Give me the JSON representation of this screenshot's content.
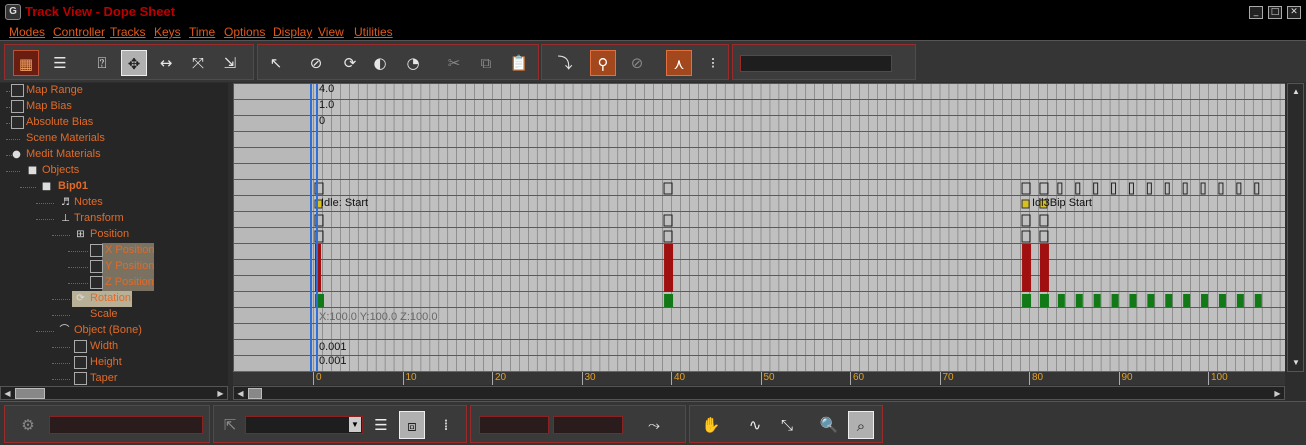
{
  "window": {
    "title": "Track View - Dope Sheet",
    "app_icon": "3ds-max-icon",
    "controls": [
      "minimize-icon",
      "maximize-icon",
      "close-icon"
    ]
  },
  "menu": [
    "Modes",
    "Controller",
    "Tracks",
    "Keys",
    "Time",
    "Options",
    "Display",
    "View",
    "Utilities"
  ],
  "toolbar": {
    "buttons": [
      "edit-keys-icon",
      "edit-ranges-icon",
      "filters-icon",
      "move-keys-icon",
      "slide-keys-icon",
      "scale-keys-icon",
      "scale-time-icon",
      "select-time-icon",
      "delete-time-icon",
      "reverse-time-icon",
      "scale-values-icon",
      "insert-time-icon",
      "cut-icon",
      "copy-icon",
      "paste-icon",
      "modify-subtree-icon",
      "modify-child-keys-icon",
      "lock-selection-icon",
      "snap-frames-icon",
      "show-keyable-icon",
      "auto-expand-icon",
      "hierarchy-icon"
    ],
    "name_field_value": ""
  },
  "tree": {
    "items": [
      {
        "label": "Map Range",
        "icon": "checkbox-icon"
      },
      {
        "label": "Map Bias",
        "icon": "checkbox-icon"
      },
      {
        "label": "Absolute Bias",
        "icon": "checkbox-icon"
      },
      {
        "label": "Scene Materials",
        "icon": ""
      },
      {
        "label": "Medit Materials",
        "icon": "sphere-icon"
      },
      {
        "label": "Objects",
        "icon": "cube-icon"
      },
      {
        "label": "Bip01",
        "icon": "cube-icon"
      },
      {
        "label": "Notes",
        "icon": "notes-icon"
      },
      {
        "label": "Transform",
        "icon": "transform-icon"
      },
      {
        "label": "Position",
        "icon": "position-icon"
      },
      {
        "label": "X Position",
        "icon": "checkbox-icon"
      },
      {
        "label": "Y Position",
        "icon": "checkbox-icon"
      },
      {
        "label": "Z Position",
        "icon": "checkbox-icon"
      },
      {
        "label": "Rotation",
        "icon": "rotation-icon"
      },
      {
        "label": "Scale",
        "icon": ""
      },
      {
        "label": "Object (Bone)",
        "icon": "bone-icon"
      },
      {
        "label": "Width",
        "icon": "checkbox-icon"
      },
      {
        "label": "Height",
        "icon": "checkbox-icon"
      },
      {
        "label": "Taper",
        "icon": "checkbox-icon"
      }
    ]
  },
  "keys": {
    "values": {
      "map_range": "4.0",
      "map_bias": "1.0",
      "absolute_bias": "0",
      "note_start": "Idle: Start",
      "note_right": "Idl3Bip Start",
      "scale": "X:100.0 Y:100.0 Z:100.0",
      "width": "0.001",
      "height": "0.001"
    },
    "key_frames": {
      "notes": [
        0,
        79,
        81
      ],
      "position_xyz": [
        0,
        39,
        79,
        81
      ],
      "rotation": [
        0,
        39,
        79,
        81,
        83,
        85,
        87,
        89,
        91,
        93,
        95,
        97,
        99,
        101,
        103,
        105
      ],
      "bip_track": [
        0,
        39,
        79,
        81,
        83,
        85,
        87,
        89,
        91,
        93,
        95,
        97,
        99,
        101,
        103,
        105
      ]
    },
    "colors": {
      "position_key": "#a01010",
      "rotation_key": "#117a17",
      "grid_line": "#9b4040",
      "time_slider": "#2e6fd8",
      "background": "#c0c0c0"
    }
  },
  "ruler": {
    "ticks": [
      "0",
      "10",
      "20",
      "30",
      "40",
      "50",
      "60",
      "70",
      "80",
      "90",
      "100"
    ]
  },
  "statusbar": {
    "buttons": [
      "zoom-extents-icon",
      "select-cursor-icon",
      "filter-list-icon",
      "select-by-name-icon",
      "track-sets-icon",
      "key-mode-icon",
      "pan-icon",
      "zoom-horizontal-extents-icon",
      "zoom-value-extents-icon",
      "zoom-icon",
      "zoom-region-icon"
    ],
    "selection_field_value": "",
    "track_set_value": "",
    "frame_value": "",
    "value_value": ""
  }
}
